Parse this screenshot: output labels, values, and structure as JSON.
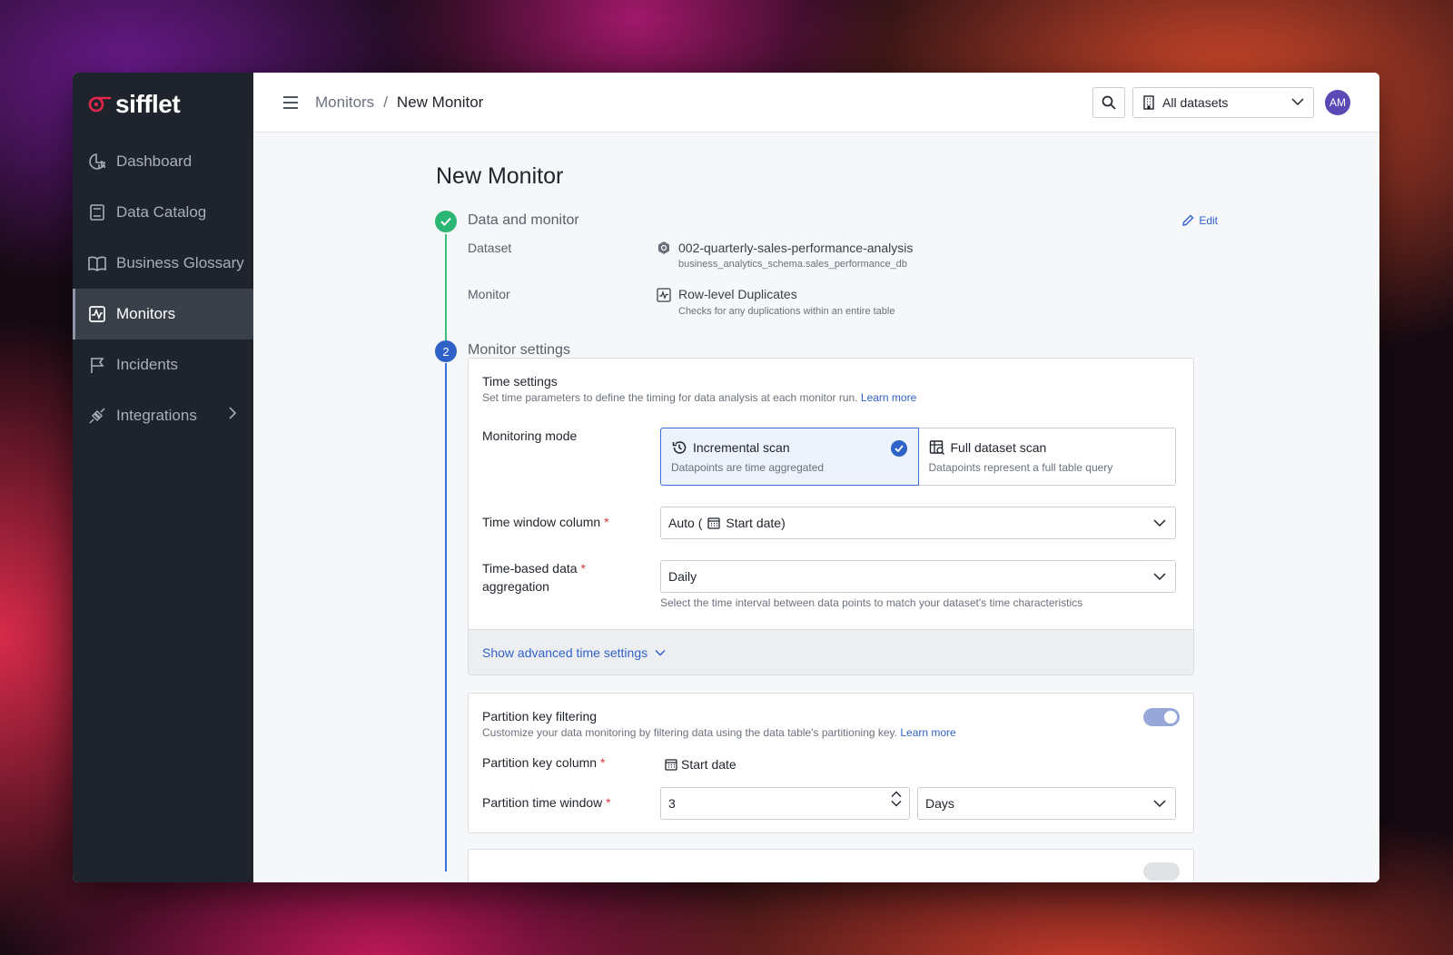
{
  "brand": {
    "name": "sifflet",
    "accent": "#e2264d"
  },
  "sidebar": {
    "items": [
      {
        "label": "Dashboard",
        "icon": "chart-pie-icon"
      },
      {
        "label": "Data Catalog",
        "icon": "book-icon"
      },
      {
        "label": "Business Glossary",
        "icon": "open-book-icon"
      },
      {
        "label": "Monitors",
        "icon": "monitor-pulse-icon",
        "active": true
      },
      {
        "label": "Incidents",
        "icon": "flag-icon"
      },
      {
        "label": "Integrations",
        "icon": "plug-icon"
      }
    ]
  },
  "header": {
    "breadcrumb": [
      "Monitors",
      "New Monitor"
    ],
    "separator": "/",
    "dataset_filter": "All datasets",
    "avatar_initials": "AM"
  },
  "page": {
    "title": "New Monitor"
  },
  "step1": {
    "number": "✓",
    "title": "Data and monitor",
    "edit_label": "Edit",
    "dataset_label": "Dataset",
    "dataset_name": "002-quarterly-sales-performance-analysis",
    "dataset_path": "business_analytics_schema.sales_performance_db",
    "monitor_label": "Monitor",
    "monitor_name": "Row-level Duplicates",
    "monitor_desc": "Checks for any duplications within an entire table"
  },
  "step2": {
    "number": "2",
    "title": "Monitor settings"
  },
  "time_settings": {
    "title": "Time settings",
    "desc": "Set time parameters to define the timing for data analysis at each monitor run.",
    "learn_more": "Learn more",
    "mode_label": "Monitoring mode",
    "modes": [
      {
        "name": "Incremental scan",
        "desc": "Datapoints are time aggregated",
        "selected": true
      },
      {
        "name": "Full dataset scan",
        "desc": "Datapoints represent a full table query",
        "selected": false
      }
    ],
    "time_window_label": "Time window column",
    "time_window_prefix": "Auto (",
    "time_window_value": "Start date",
    "time_window_suffix": ")",
    "aggregation_label_1": "Time-based data",
    "aggregation_label_2": "aggregation",
    "aggregation_value": "Daily",
    "aggregation_help": "Select the time interval between data points to match your dataset's time characteristics",
    "advanced_label": "Show advanced time settings"
  },
  "partition": {
    "title": "Partition key filtering",
    "desc": "Customize your data monitoring by filtering data using the data table's partitioning key.",
    "learn_more": "Learn more",
    "enabled": true,
    "key_column_label": "Partition key column",
    "key_column_value": "Start date",
    "time_window_label": "Partition time window",
    "time_window_value": "3",
    "time_window_unit": "Days"
  },
  "required_marker": "*"
}
